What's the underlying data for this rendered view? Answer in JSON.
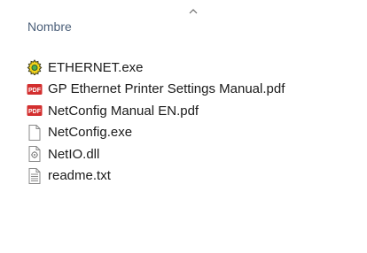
{
  "header": {
    "column_name": "Nombre",
    "sort_indicator_icon": "chevron-up-icon"
  },
  "files": [
    {
      "name": "ETHERNET.exe",
      "icon": "gear-app-icon"
    },
    {
      "name": "GP Ethernet Printer Settings Manual.pdf",
      "icon": "pdf-icon"
    },
    {
      "name": "NetConfig Manual EN.pdf",
      "icon": "pdf-icon"
    },
    {
      "name": "NetConfig.exe",
      "icon": "blank-file-icon"
    },
    {
      "name": "NetIO.dll",
      "icon": "dll-file-icon"
    },
    {
      "name": "readme.txt",
      "icon": "text-file-icon"
    }
  ],
  "colors": {
    "header_text": "#4c607a",
    "pdf_red": "#d32f2f",
    "gear_yellow": "#f2d21b"
  }
}
